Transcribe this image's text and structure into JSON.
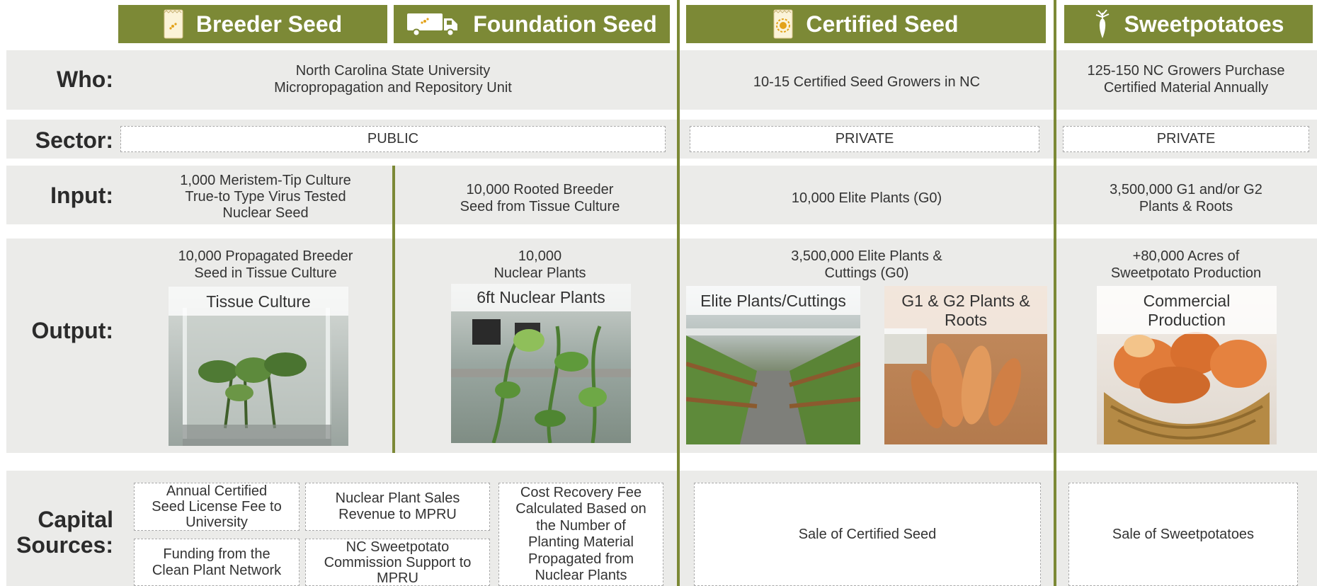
{
  "headers": {
    "breeder": "Breeder Seed",
    "foundation": "Foundation Seed",
    "certified": "Certified Seed",
    "sweet": "Sweetpotatoes"
  },
  "rows": {
    "who": "Who:",
    "sector": "Sector:",
    "input": "Input:",
    "output": "Output:",
    "capital_1": "Capital",
    "capital_2": "Sources:"
  },
  "who": {
    "public_1": "North Carolina State University",
    "public_2": "Micropropagation and Repository Unit",
    "certified": "10-15 Certified Seed Growers in NC",
    "sweet_1": "125-150 NC Growers Purchase",
    "sweet_2": "Certified Material Annually"
  },
  "sector": {
    "public": "PUBLIC",
    "certified": "PRIVATE",
    "sweet": "PRIVATE"
  },
  "input": {
    "breeder_1": "1,000 Meristem-Tip Culture",
    "breeder_2": "True-to Type Virus Tested",
    "breeder_3": "Nuclear Seed",
    "foundation_1": "10,000 Rooted Breeder",
    "foundation_2": "Seed from Tissue Culture",
    "certified": "10,000 Elite Plants (G0)",
    "sweet_1": "3,500,000 G1 and/or G2",
    "sweet_2": "Plants & Roots"
  },
  "output": {
    "breeder_1": "10,000 Propagated Breeder",
    "breeder_2": "Seed in Tissue Culture",
    "foundation_1": "10,000",
    "foundation_2": "Nuclear Plants",
    "certified_1": "3,500,000 Elite Plants &",
    "certified_2": "Cuttings (G0)",
    "sweet_1": "+80,000 Acres of",
    "sweet_2": "Sweetpotato Production"
  },
  "photos": {
    "tissue": "Tissue Culture",
    "nuclear": "6ft Nuclear Plants",
    "elite": "Elite Plants/Cuttings",
    "g1g2_1": "G1 & G2 Plants &",
    "g1g2_2": "Roots",
    "commercial_1": "Commercial",
    "commercial_2": "Production"
  },
  "capital": {
    "license_1": "Annual Certified",
    "license_2": "Seed License Fee to",
    "license_3": "University",
    "sales_1": "Nuclear Plant Sales",
    "sales_2": "Revenue to MPRU",
    "fee_1": "Cost Recovery Fee",
    "fee_2": "Calculated Based on",
    "fee_3": "the Number of",
    "fee_4": "Planting Material",
    "fee_5": "Propagated from",
    "fee_6": "Nuclear Plants",
    "cpn_1": "Funding from the",
    "cpn_2": "Clean Plant Network",
    "commission_1": "NC Sweetpotato",
    "commission_2": "Commission Support to",
    "commission_3": "MPRU",
    "certified": "Sale of Certified Seed",
    "sweet": "Sale of Sweetpotatoes"
  },
  "colors": {
    "accent": "#7c8936",
    "band": "#ebebe9",
    "text": "#333333"
  },
  "icons": {
    "breeder": "seed-packet-icon",
    "foundation": "delivery-truck-icon",
    "certified": "certified-seed-packet-icon",
    "sweet": "sweetpotato-icon"
  }
}
